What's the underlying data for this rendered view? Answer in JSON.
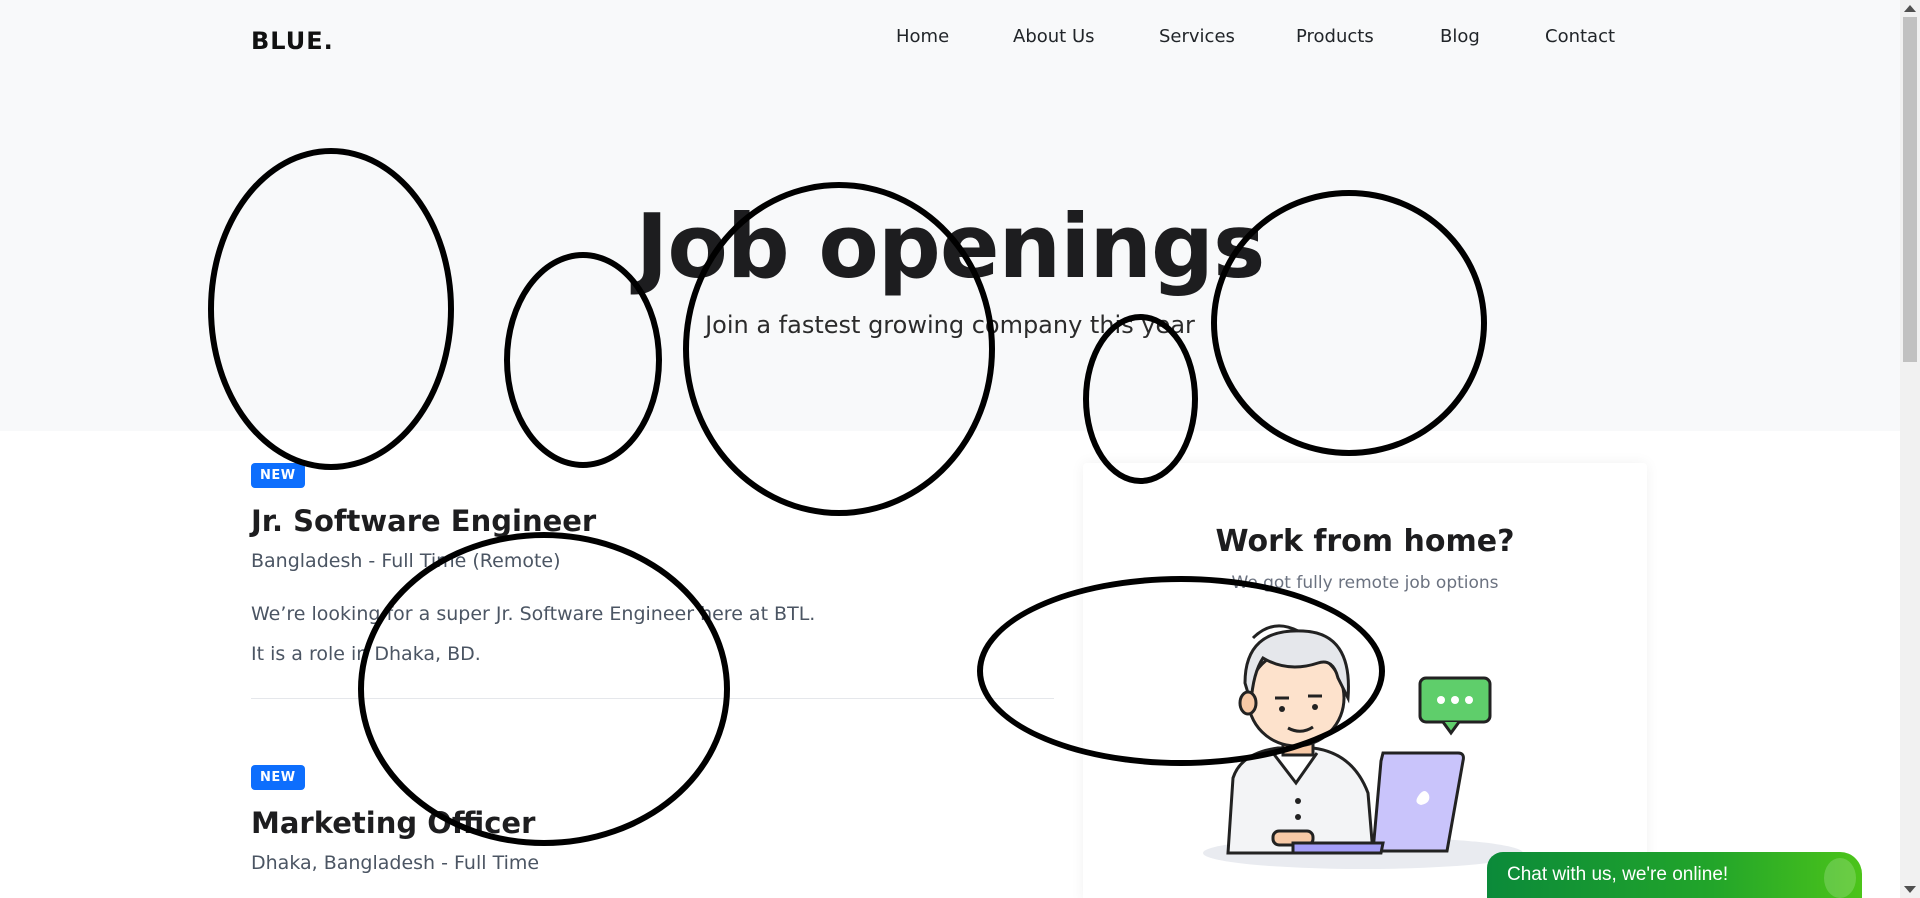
{
  "nav": {
    "logo": "BLUE.",
    "links": [
      "Home",
      "About Us",
      "Services",
      "Products",
      "Blog",
      "Contact"
    ]
  },
  "hero": {
    "title": "Job openings",
    "subtitle": "Join a fastest growing company this year"
  },
  "jobs": [
    {
      "badge": "NEW",
      "title": "Jr. Software Engineer",
      "meta": "Bangladesh - Full Time (Remote)",
      "desc_line1": "We’re looking for a super Jr. Software Engineer here at BTL.",
      "desc_line2": "It is a role in Dhaka, BD."
    },
    {
      "badge": "NEW",
      "title": "Marketing Officer",
      "meta": "Dhaka, Bangladesh - Full Time"
    }
  ],
  "wfh": {
    "title": "Work from home?",
    "subtitle": "We got fully remote job options"
  },
  "chat": {
    "label": "Chat with us, we're online!"
  },
  "colors": {
    "badge": "#0d6efd",
    "hero_bg": "#f8f9fa",
    "chat_start": "#0b8a3a",
    "chat_end": "#4cc41a",
    "laptop": "#c9c4fb",
    "speech_bubble": "#5fce6b"
  }
}
